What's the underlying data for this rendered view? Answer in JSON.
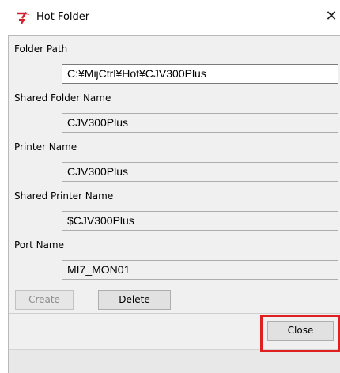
{
  "window": {
    "title": "Hot Folder",
    "close_glyph": "✕",
    "icon": "app-logo-icon"
  },
  "fields": [
    {
      "label": "Folder Path",
      "value": "C:¥MijCtrl¥Hot¥CJV300Plus"
    },
    {
      "label": "Shared Folder Name",
      "value": "CJV300Plus"
    },
    {
      "label": "Printer Name",
      "value": "CJV300Plus"
    },
    {
      "label": "Shared Printer Name",
      "value": "$CJV300Plus"
    },
    {
      "label": "Port Name",
      "value": "MI7_MON01"
    }
  ],
  "buttons": {
    "create": "Create",
    "delete": "Delete",
    "close": "Close"
  },
  "colors": {
    "highlight": "#e02020",
    "client_bg": "#f0f0f0",
    "button_bg": "#e1e1e1"
  }
}
